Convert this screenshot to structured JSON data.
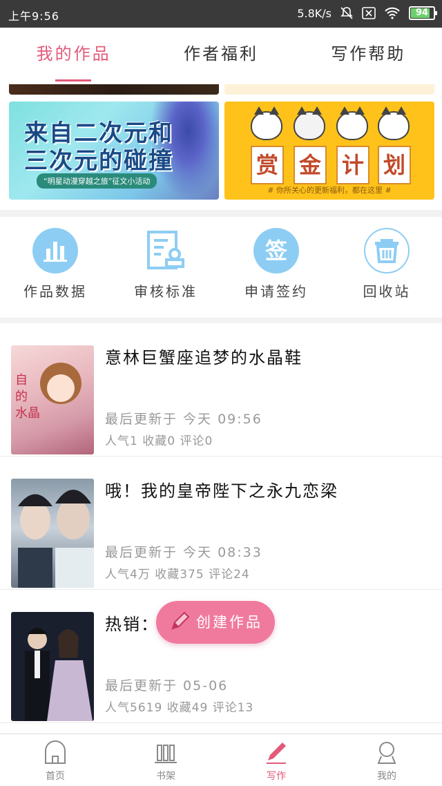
{
  "status_bar": {
    "time": "上午9:56",
    "network_speed": "5.8K/s",
    "battery": "94"
  },
  "tabs": [
    {
      "label": "我的作品",
      "active": true
    },
    {
      "label": "作者福利",
      "active": false
    },
    {
      "label": "写作帮助",
      "active": false
    }
  ],
  "banners": {
    "left": {
      "line1": "来自二次元和",
      "line2": "三次元的碰撞",
      "subtitle": "“明星动漫穿越之旅”征文小活动"
    },
    "right": {
      "chars": [
        "赏",
        "金",
        "计",
        "划"
      ],
      "footer": "# 你所关心的更新福利，都在这里 #"
    }
  },
  "functions": [
    {
      "label": "作品数据",
      "icon": "bar-chart-icon"
    },
    {
      "label": "审核标准",
      "icon": "review-document-icon"
    },
    {
      "label": "申请签约",
      "icon": "sign-icon",
      "glyph": "签"
    },
    {
      "label": "回收站",
      "icon": "trash-icon"
    }
  ],
  "works": [
    {
      "title": "意林巨蟹座追梦的水晶鞋",
      "updated": "最后更新于 今天 09:56",
      "stats": "人气1 收藏0 评论0"
    },
    {
      "title": "哦！我的皇帝陛下之永九恋梁",
      "updated": "最后更新于 今天 08:33",
      "stats": "人气4万 收藏375 评论24"
    },
    {
      "title": "热销：最",
      "updated": "最后更新于 05-06",
      "stats": "人气5619 收藏49 评论13"
    }
  ],
  "create_button": {
    "label": "创建作品"
  },
  "bottom_nav": [
    {
      "label": "首页",
      "active": false
    },
    {
      "label": "书架",
      "active": false
    },
    {
      "label": "写作",
      "active": true
    },
    {
      "label": "我的",
      "active": false
    }
  ],
  "colors": {
    "accent": "#e35a7a",
    "icon_blue": "#8dcdf3",
    "create_button": "#f07a9e"
  }
}
